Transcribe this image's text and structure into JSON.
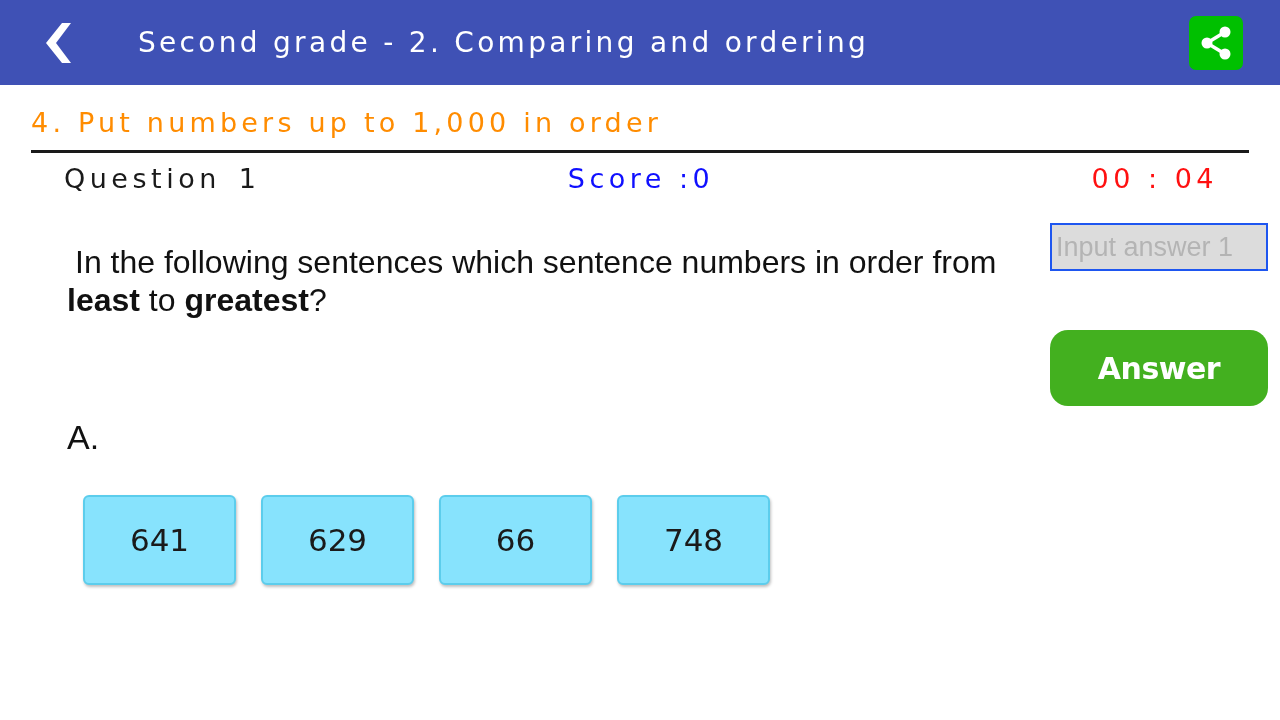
{
  "header": {
    "title": "Second grade - 2. Comparing and ordering"
  },
  "lesson_title": "4. Put numbers up to 1,000 in order",
  "status_bar": {
    "question_label": "Question",
    "question_number": "1",
    "score": "Score :0",
    "timer": "00 : 04"
  },
  "question": {
    "text": "In the following sentences which sentence numbers in order from **least** to **greatest**?"
  },
  "answer_field": {
    "placeholder": "Input answer 1"
  },
  "answer_button": {
    "label": "Answer"
  },
  "options": [
    {
      "label": "A.",
      "tiles": [
        "641",
        "629",
        "66",
        "748"
      ]
    }
  ]
}
